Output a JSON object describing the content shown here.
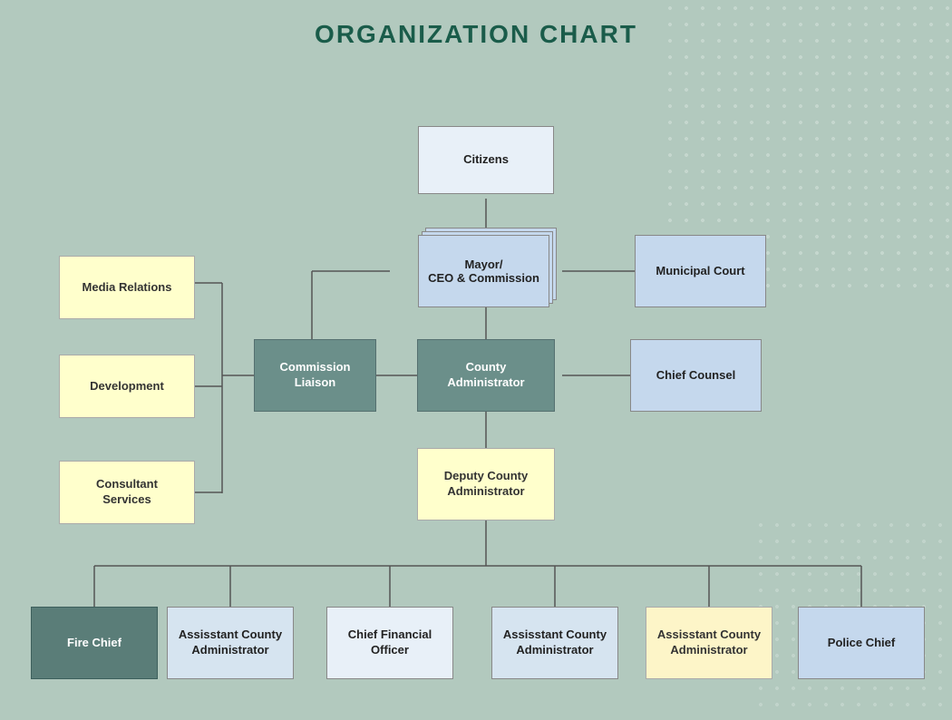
{
  "title": "ORGANIZATION CHART",
  "boxes": {
    "citizens": {
      "label": "Citizens"
    },
    "mayor": {
      "label": "Mayor/\nCEO & Commission"
    },
    "municipal_court": {
      "label": "Municipal Court"
    },
    "media_relations": {
      "label": "Media Relations"
    },
    "development": {
      "label": "Development"
    },
    "consultant_services": {
      "label": "Consultant\nServices"
    },
    "commission_liaison": {
      "label": "Commission\nLiaison"
    },
    "county_admin": {
      "label": "County\nAdministrator"
    },
    "chief_counsel": {
      "label": "Chief Counsel"
    },
    "deputy_county_admin": {
      "label": "Deputy County\nAdministrator"
    },
    "fire_chief": {
      "label": "Fire Chief"
    },
    "asst_admin_1": {
      "label": "Assisstant County\nAdministrator"
    },
    "cfo": {
      "label": "Chief Financial\nOfficer"
    },
    "asst_admin_2": {
      "label": "Assisstant County\nAdministrator"
    },
    "asst_admin_3": {
      "label": "Assisstant County\nAdministrator"
    },
    "police_chief": {
      "label": "Police Chief"
    }
  },
  "colors": {
    "background": "#b2c9be",
    "title": "#1a5c4a",
    "yellow": "#ffffcc",
    "light_blue": "#c5d8ed",
    "teal": "#6b8f8a",
    "white_blue": "#e8f0f8"
  }
}
